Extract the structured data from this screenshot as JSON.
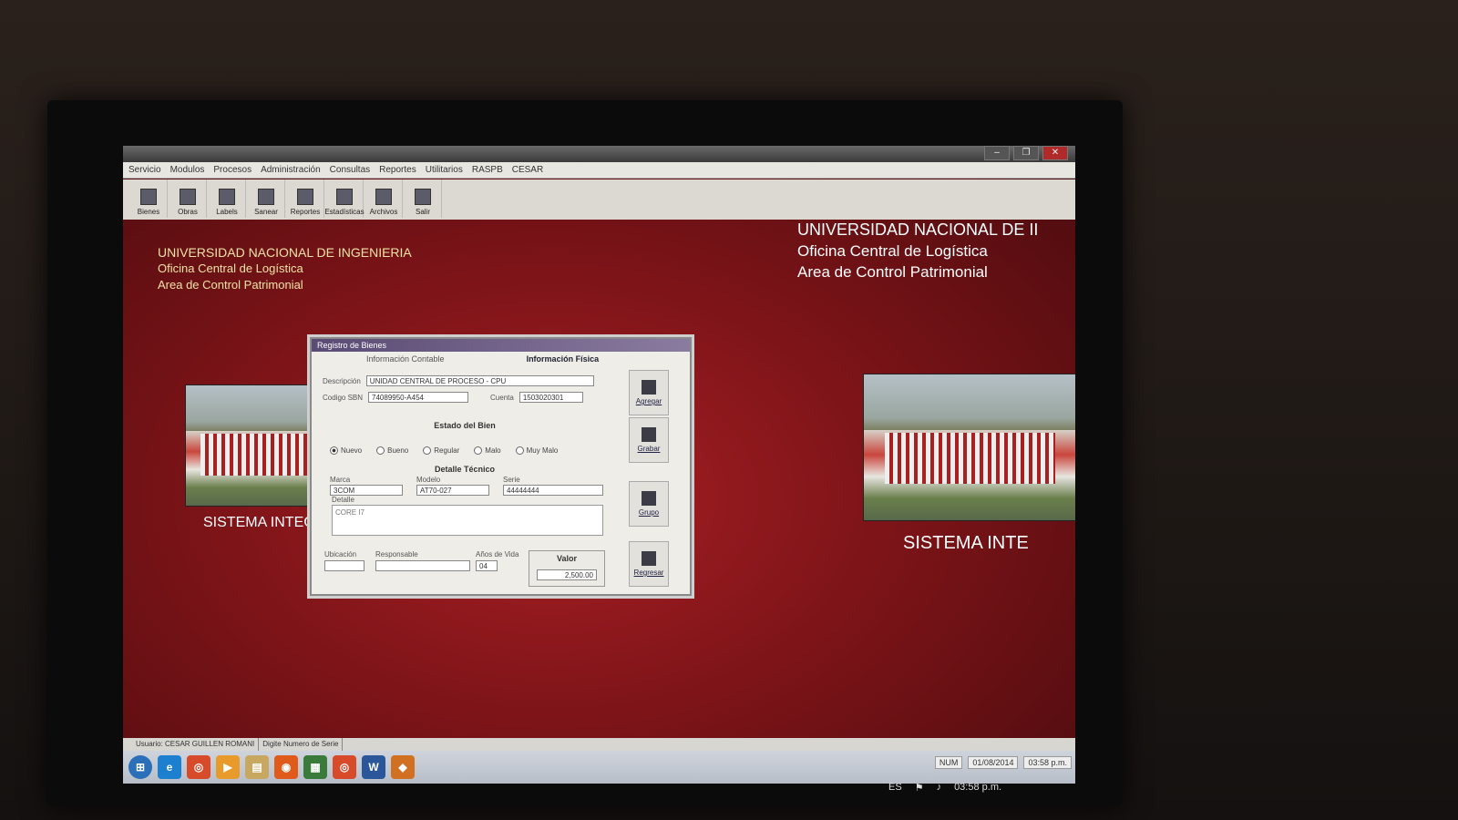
{
  "window": {
    "controls": [
      "–",
      "❐",
      "✕"
    ]
  },
  "menubar": [
    "Servicio",
    "Modulos",
    "Procesos",
    "Administración",
    "Consultas",
    "Reportes",
    "Utilitarios",
    "RASPB",
    "CESAR"
  ],
  "toolbar": [
    {
      "label": "Bienes"
    },
    {
      "label": "Obras"
    },
    {
      "label": "Labels"
    },
    {
      "label": "Sanear"
    },
    {
      "label": "Reportes"
    },
    {
      "label": "Estadísticas"
    },
    {
      "label": "Archivos"
    },
    {
      "label": "Salir"
    }
  ],
  "header_left": {
    "university": "UNIVERSIDAD NACIONAL DE INGENIERIA",
    "office": "Oficina Central de Logística",
    "area": "Area de Control Patrimonial"
  },
  "header_right": {
    "university": "UNIVERSIDAD NACIONAL DE II",
    "office": "Oficina Central de Logística",
    "area": "Area de Control Patrimonial"
  },
  "sistema_left": "SISTEMA INTEGI",
  "sistema_right": "SISTEMA INTE",
  "dialog": {
    "title": "Registro de Bienes",
    "tabs": [
      "Información Contable",
      "Información Física"
    ],
    "descripcion_label": "Descripción",
    "descripcion_value": "UNIDAD CENTRAL DE PROCESO - CPU",
    "codigo_label": "Codigo SBN",
    "codigo_value": "74089950-A454",
    "cuenta_label": "Cuenta",
    "cuenta_value": "1503020301",
    "estado_title": "Estado del Bien",
    "estados": [
      "Nuevo",
      "Bueno",
      "Regular",
      "Malo",
      "Muy Malo"
    ],
    "estado_selected": "Nuevo",
    "detalle_title": "Detalle Técnico",
    "marca_label": "Marca",
    "marca_value": "3COM",
    "modelo_label": "Modelo",
    "modelo_value": "AT70-027",
    "serie_label": "Serie",
    "serie_value": "44444444",
    "detalle_label": "Detalle",
    "detalle_value": "CORE I7",
    "ubicacion_label": "Ubicación",
    "responsable_label": "Responsable",
    "anios_label": "Años de Vida",
    "anios_value": "04",
    "valor_label": "Valor",
    "valor_value": "2,500.00",
    "buttons": {
      "agregar": "Agregar",
      "grabar": "Grabar",
      "grupo": "Grupo",
      "regresar": "Regresar"
    }
  },
  "statusbar": {
    "user": "Usuario: CESAR GUILLEN ROMANI",
    "hint": "Digite Numero de Serie"
  },
  "tray": {
    "num": "NUM",
    "date": "01/08/2014",
    "time": "03:58 p.m."
  },
  "system_tray": {
    "lang": "ES",
    "time": "03:58 p.m."
  }
}
